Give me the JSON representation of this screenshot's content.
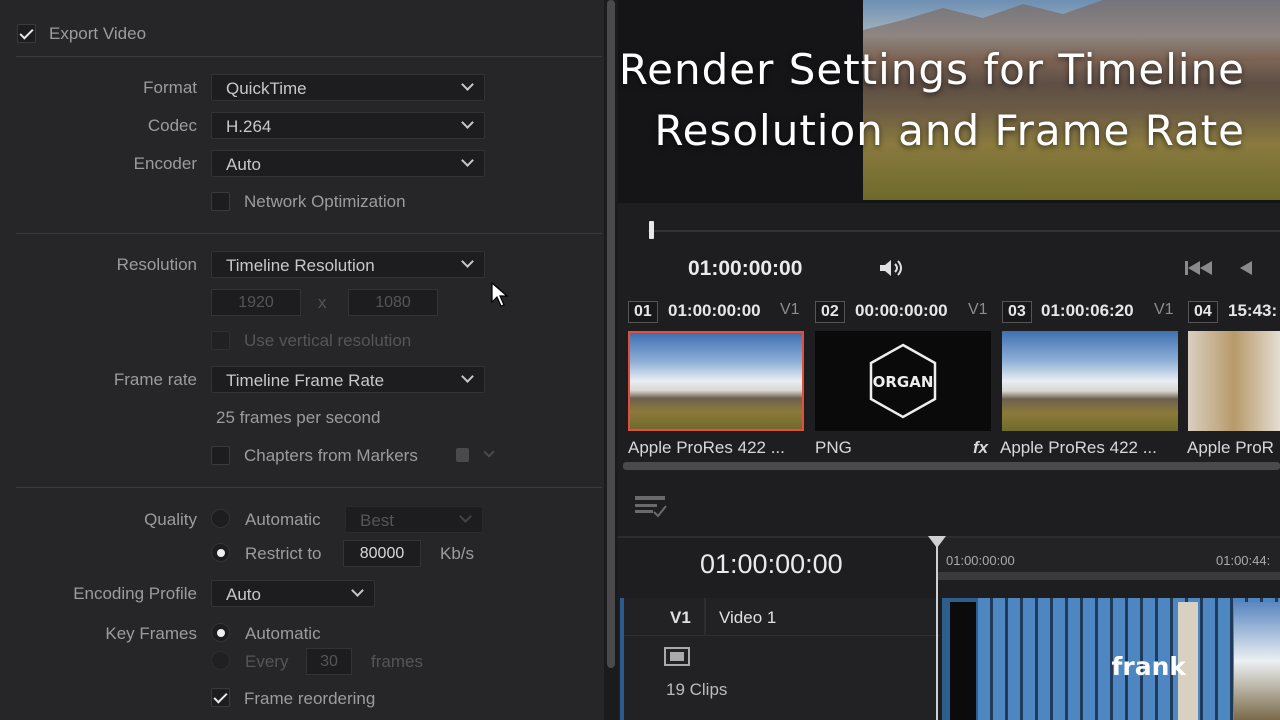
{
  "export": {
    "label": "Export Video",
    "checked": true
  },
  "format": {
    "label": "Format",
    "value": "QuickTime"
  },
  "codec": {
    "label": "Codec",
    "value": "H.264"
  },
  "encoder": {
    "label": "Encoder",
    "value": "Auto"
  },
  "network_opt": {
    "label": "Network Optimization",
    "checked": false
  },
  "resolution": {
    "label": "Resolution",
    "value": "Timeline Resolution",
    "width": "1920",
    "x": "x",
    "height": "1080"
  },
  "vertical": {
    "label": "Use vertical resolution"
  },
  "frame_rate": {
    "label": "Frame rate",
    "value": "Timeline Frame Rate",
    "info": "25 frames per second"
  },
  "chapters": {
    "label": "Chapters from Markers"
  },
  "quality": {
    "label": "Quality",
    "automatic": "Automatic",
    "best": "Best",
    "restrict": "Restrict to",
    "kbps_value": "80000",
    "kbps_unit": "Kb/s"
  },
  "encoding_profile": {
    "label": "Encoding Profile",
    "value": "Auto"
  },
  "key_frames": {
    "label": "Key Frames",
    "automatic": "Automatic",
    "every": "Every",
    "every_value": "30",
    "frames": "frames"
  },
  "frame_reordering": {
    "label": "Frame reordering",
    "checked": true
  },
  "viewer": {
    "title_line1": "Render Settings for Timeline",
    "title_line2": "Resolution and Frame Rate",
    "timecode": "01:00:00:00"
  },
  "clips": [
    {
      "num": "01",
      "tc": "01:00:00:00",
      "track": "V1",
      "name": "Apple ProRes 422 ..."
    },
    {
      "num": "02",
      "tc": "00:00:00:00",
      "track": "V1",
      "name": "PNG",
      "logo": "ORGAN"
    },
    {
      "num": "03",
      "tc": "01:00:06:20",
      "track": "V1",
      "name": "Apple ProRes 422 ..."
    },
    {
      "num": "04",
      "tc": "15:43:",
      "track": "",
      "name": "Apple ProR"
    }
  ],
  "fx_label": "fx",
  "timeline": {
    "timecode": "01:00:00:00",
    "ruler_start": "01:00:00:00",
    "ruler_end": "01:00:44:",
    "track_id": "V1",
    "track_name": "Video 1",
    "clip_count": "19 Clips"
  },
  "watermark": "frank"
}
